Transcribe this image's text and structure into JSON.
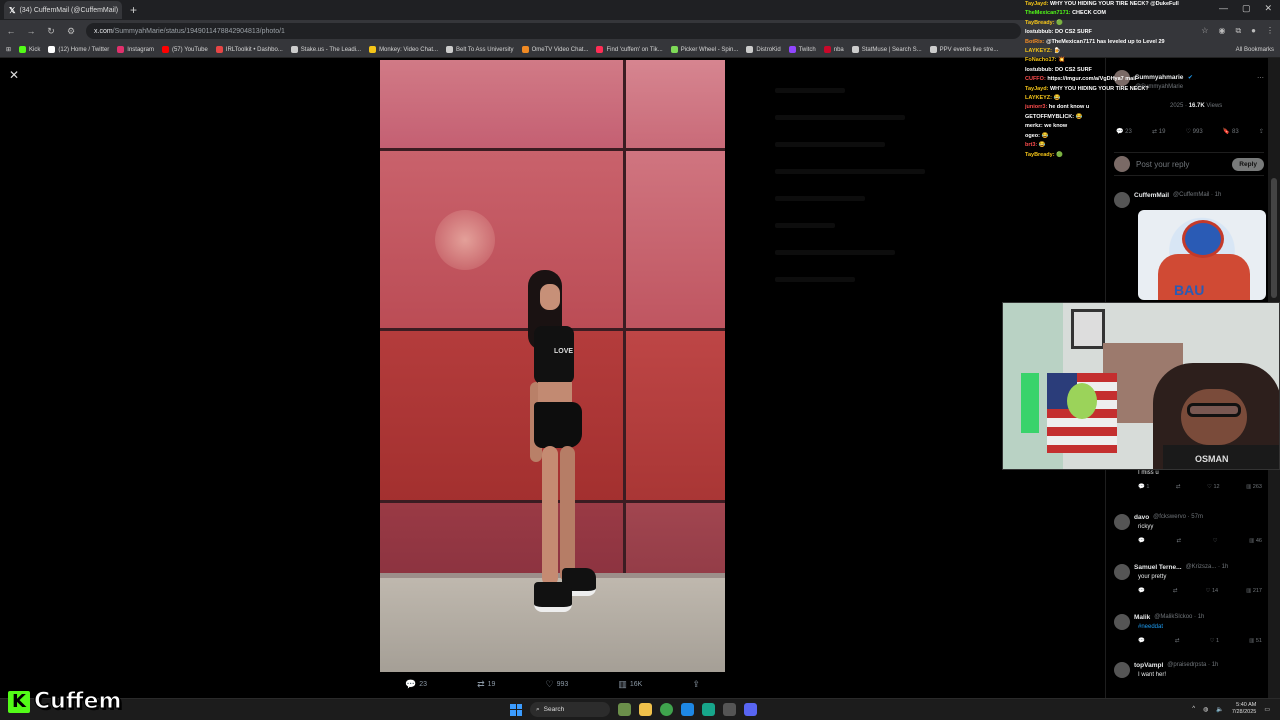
{
  "browser": {
    "tab_title": "(34) CuffemMail (@CuffemMail)",
    "new_tab": "+",
    "url_host": "x.com",
    "url_path": "/SummyahMarie/status/1949011478842904813/photo/1",
    "bookmarks": [
      {
        "label": "Kick",
        "color": "#53fc18"
      },
      {
        "label": "(12) Home / Twitter",
        "color": "#ffffff"
      },
      {
        "label": "Instagram",
        "color": "#e1306c"
      },
      {
        "label": "(57) YouTube",
        "color": "#ff0000"
      },
      {
        "label": "IRLToolkit • Dashbo...",
        "color": "#e84545"
      },
      {
        "label": "Stake.us - The Leadi...",
        "color": "#cccccc"
      },
      {
        "label": "Monkey: Video Chat...",
        "color": "#f5c518"
      },
      {
        "label": "Belt To Ass University",
        "color": "#cccccc"
      },
      {
        "label": "OmeTV Video Chat...",
        "color": "#f08a24"
      },
      {
        "label": "Find 'cuffem' on Tik...",
        "color": "#ff2d55"
      },
      {
        "label": "Picker Wheel - Spin...",
        "color": "#7ed957"
      },
      {
        "label": "DistroKid",
        "color": "#cccccc"
      },
      {
        "label": "Twitch",
        "color": "#9146ff"
      },
      {
        "label": "nba",
        "color": "#c9082a"
      },
      {
        "label": "StatMuse | Search S...",
        "color": "#cccccc"
      },
      {
        "label": "PPV events live stre...",
        "color": "#cccccc"
      }
    ],
    "all_bookmarks": "All Bookmarks"
  },
  "photo_actions": {
    "replies": "23",
    "reposts": "19",
    "likes": "993",
    "views": "16K"
  },
  "shirt_text": "LOVE",
  "chat": [
    {
      "user": "TayJayd:",
      "color": "#f5c518",
      "text": "WHY YOU HIDING YOUR TIRE NECK? @DukeFull"
    },
    {
      "user": "TheMexican7171:",
      "color": "#53fc18",
      "text": "CHECK COM"
    },
    {
      "user": "TayBready:",
      "color": "#f5c518",
      "text": "🟢"
    },
    {
      "user": "lostubbub:",
      "color": "#ffffff",
      "text": "DO CS2 SURF"
    },
    {
      "user": "BotRix:",
      "color": "#f08a24",
      "text": "@TheMexican7171 has leveled up to Level 29"
    },
    {
      "user": "LAYKEYZ:",
      "color": "#f5c518",
      "text": "🍺"
    },
    {
      "user": "FoNacho17:",
      "color": "#f5c518",
      "text": "💥"
    },
    {
      "user": "lostubbub:",
      "color": "#ffffff",
      "text": "DO CS2 SURF"
    },
    {
      "user": "CUFFO:",
      "color": "#ff4d4d",
      "text": "https://imgur.com/a/VgDHya7 mail"
    },
    {
      "user": "TayJayd:",
      "color": "#f5c518",
      "text": "WHY YOU HIDING YOUR TIRE NECK?"
    },
    {
      "user": "LAYKEYZ:",
      "color": "#f5c518",
      "text": "😂"
    },
    {
      "user": "juniorr3:",
      "color": "#ff4d4d",
      "text": "he dont know u"
    },
    {
      "user": "GETOFFMYBLICK:",
      "color": "#ffffff",
      "text": "😂"
    },
    {
      "user": "merkz:",
      "color": "#ffffff",
      "text": "we know"
    },
    {
      "user": "ogeo:",
      "color": "#ffffff",
      "text": "😂"
    },
    {
      "user": "brt3:",
      "color": "#ff4d4d",
      "text": "😂"
    },
    {
      "user": "TayBready:",
      "color": "#f5c518",
      "text": "🟢"
    }
  ],
  "thread": {
    "author_name": "Summyahmarie",
    "author_handle": "@SummyahMarie",
    "meta_date": "2025",
    "meta_views": "16.7K",
    "meta_views_label": "Views",
    "stats": {
      "replies": "23",
      "reposts": "19",
      "likes": "993",
      "bookmarks": "83"
    },
    "reply_placeholder": "Post your reply",
    "reply_button": "Reply",
    "first_reply": {
      "name": "CuffemMail",
      "handle": "@CuffemMail · 1h",
      "media_text": "BAU"
    },
    "replies": [
      {
        "name": "",
        "handle": "",
        "text": "I miss u",
        "stats": [
          "1",
          "",
          "12",
          "263"
        ]
      },
      {
        "name": "davo",
        "handle": "@fckswervo · 57m",
        "text": "rickyy",
        "stats": [
          "",
          "",
          "",
          "46"
        ]
      },
      {
        "name": "Samuel Terne...",
        "handle": "@Krizsza... · 1h",
        "text": "your pretty",
        "stats": [
          "",
          "",
          "14",
          "217"
        ]
      },
      {
        "name": "Malik",
        "handle": "@MalikSlckoo · 1h",
        "text": "#needdat",
        "stats": [
          "",
          "",
          "1",
          "51"
        ]
      },
      {
        "name": "topVampl",
        "handle": "@praisedrpsta · 1h",
        "text": "I want her!",
        "stats": []
      }
    ]
  },
  "webcam": {
    "shirt_text": "OSMAN"
  },
  "taskbar": {
    "search_label": "Search",
    "time": "5:40 AM",
    "date": "7/28/2025"
  },
  "brand": {
    "logo_letter": "K",
    "name": "Cuffem"
  }
}
